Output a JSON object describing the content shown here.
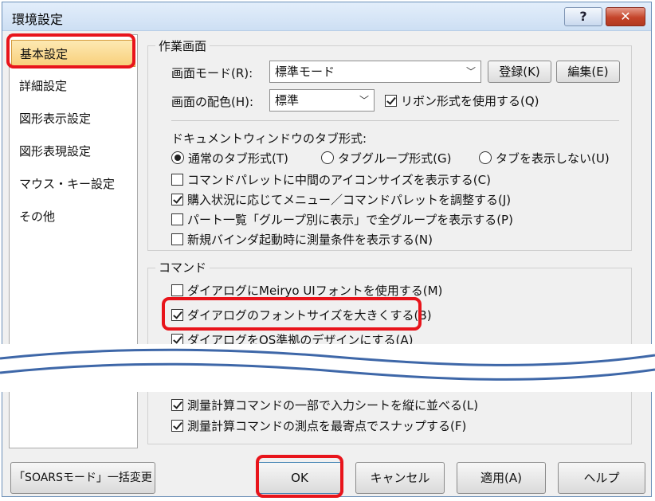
{
  "window": {
    "title": "環境設定",
    "help_label": "?",
    "close_label": "✕"
  },
  "sidebar": {
    "items": [
      {
        "label": "基本設定",
        "selected": true
      },
      {
        "label": "詳細設定"
      },
      {
        "label": "図形表示設定"
      },
      {
        "label": "図形表現設定"
      },
      {
        "label": "マウス・キー設定"
      },
      {
        "label": "その他"
      }
    ]
  },
  "work_area": {
    "group_label": "作業画面",
    "screen_mode_label": "画面モード(R):",
    "screen_mode_value": "標準モード",
    "register_button": "登録(K)",
    "edit_button": "編集(E)",
    "color_label": "画面の配色(H):",
    "color_value": "標準",
    "ribbon_label": "リボン形式を使用する(Q)",
    "ribbon_checked": true,
    "tab_style_label": "ドキュメントウィンドウのタブ形式:",
    "tab_options": [
      {
        "label": "通常のタブ形式(T)",
        "selected": true
      },
      {
        "label": "タブグループ形式(G)",
        "selected": false
      },
      {
        "label": "タブを表示しない(U)",
        "selected": false
      }
    ],
    "checkboxes": [
      {
        "label": "コマンドパレットに中間のアイコンサイズを表示する(C)",
        "checked": false
      },
      {
        "label": "購入状況に応じてメニュー／コマンドパレットを調整する(J)",
        "checked": true
      },
      {
        "label": "パート一覧「グループ別に表示」で全グループを表示する(P)",
        "checked": false
      },
      {
        "label": "新規バインダ起動時に測量条件を表示する(N)",
        "checked": false
      }
    ]
  },
  "command": {
    "group_label": "コマンド",
    "checkboxes": [
      {
        "label": "ダイアログにMeiryo UIフォントを使用する(M)",
        "checked": false
      },
      {
        "label": "ダイアログのフォントサイズを大きくする(B)",
        "checked": true
      },
      {
        "label": "ダイアログをOS準拠のデザインにする(A)",
        "checked": true
      }
    ],
    "lower_checkboxes": [
      {
        "label": "測量計算コマンドの一部で入力シートを縦に並べる(L)",
        "checked": true
      },
      {
        "label": "測量計算コマンドの測点を最寄点でスナップする(F)",
        "checked": true
      }
    ]
  },
  "footer": {
    "soars_button": "「SOARSモード」一括変更",
    "ok_button": "OK",
    "cancel_button": "キャンセル",
    "apply_button": "適用(A)",
    "help_button": "ヘルプ"
  },
  "colors": {
    "highlight": "#e8141b",
    "selected_item": "#f8cf7a",
    "close_button": "#c4442a"
  }
}
